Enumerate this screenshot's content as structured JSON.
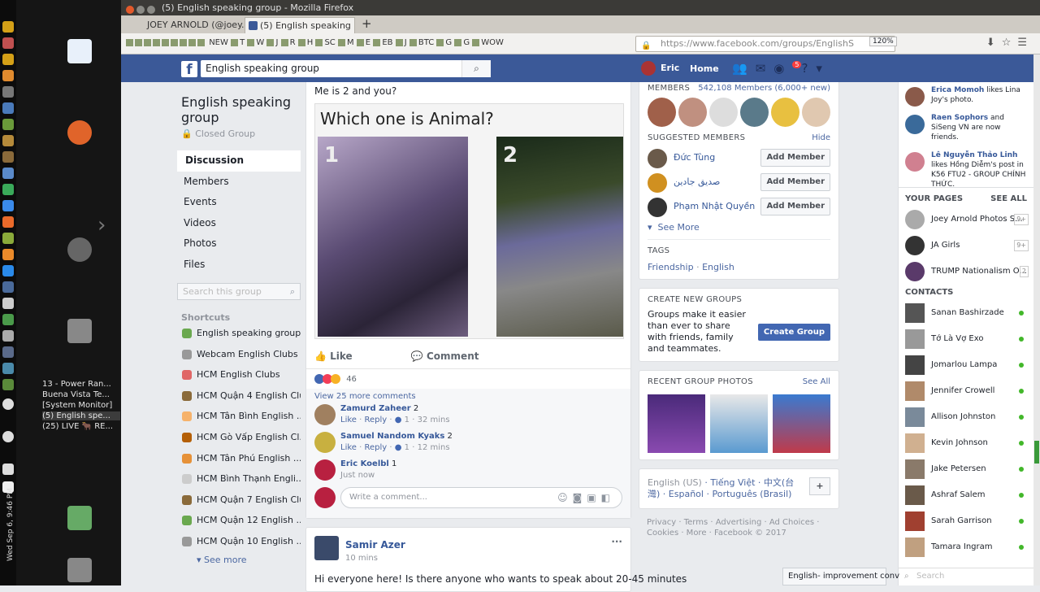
{
  "desktop": {
    "windows": [
      "13 - Power Ran...",
      "Buena Vista Te...",
      "[System Monitor]",
      "(5) English spe...",
      "(25) LIVE 🐂 RE..."
    ],
    "clock": "Wed Sep 6, 9:46 PM",
    "lang": "en"
  },
  "browser": {
    "title": "(5) English speaking group - Mozilla Firefox",
    "tabs": [
      {
        "label": "JOEY ARNOLD (@joey..."
      },
      {
        "label": "(5) English speaking gr..."
      }
    ],
    "bookmarks": [
      "NEW",
      "T",
      "W",
      "J",
      "R",
      "H",
      "SC",
      "M",
      "E",
      "EB",
      "J",
      "BTC",
      "G",
      "G",
      "WOW"
    ],
    "url": "https://www.facebook.com/groups/EnglishS",
    "zoom": "120%"
  },
  "fb": {
    "search_value": "English speaking group",
    "user": "Eric",
    "home": "Home",
    "notif_count": "5"
  },
  "left": {
    "group_name": "English speaking group",
    "privacy": "Closed Group",
    "nav": [
      "Discussion",
      "Members",
      "Events",
      "Videos",
      "Photos",
      "Files"
    ],
    "search_placeholder": "Search this group",
    "shortcuts_title": "Shortcuts",
    "shortcuts": [
      "English speaking group",
      "Webcam English Clubs",
      "HCM English Clubs",
      "HCM Quận 4 English Club",
      "HCM Tân Bình English ...",
      "HCM Gò Vấp English Cl...",
      "HCM Tân Phú English ...",
      "HCM Bình Thạnh Engli...",
      "HCM Quận 7 English Club",
      "HCM Quận 12 English ...",
      "HCM Quận 10 English ..."
    ],
    "see_more": "See more"
  },
  "post": {
    "text": "Me is 2 and you?",
    "meme_question": "Which one is Animal?",
    "meme_n1": "1",
    "meme_n2": "2",
    "like": "Like",
    "comment": "Comment",
    "reaction_count": "46",
    "view_more": "View 25 more comments",
    "comments": [
      {
        "name": "Zamurd Zaheer",
        "text": "2",
        "like": "Like",
        "reply": "Reply",
        "count": "1",
        "time": "32 mins"
      },
      {
        "name": "Samuel Nandom Kyaks",
        "text": "2",
        "like": "Like",
        "reply": "Reply",
        "count": "1",
        "time": "12 mins"
      },
      {
        "name": "Eric Koelbl",
        "text": "1",
        "time": "Just now"
      }
    ],
    "write_placeholder": "Write a comment..."
  },
  "post2": {
    "name": "Samir Azer",
    "time": "10 mins",
    "text": "Hi everyone here! Is there anyone who wants to speak about 20-45 minutes"
  },
  "right": {
    "members_title": "MEMBERS",
    "members_count": "542,108 Members (6,000+ new)",
    "suggested_title": "SUGGESTED MEMBERS",
    "hide": "Hide",
    "suggested": [
      {
        "name": "Đức Tùng"
      },
      {
        "name": "صديق جادين"
      },
      {
        "name": "Phạm Nhật Quyền"
      }
    ],
    "add_member": "Add Member",
    "see_more": "See More",
    "tags_title": "TAGS",
    "tag1": "Friendship",
    "tag2": "English",
    "create_title": "CREATE NEW GROUPS",
    "create_text": "Groups make it easier than ever to share with friends, family and teammates.",
    "create_btn": "Create Group",
    "photos_title": "RECENT GROUP PHOTOS",
    "see_all": "See All",
    "langs_current": "English (US)",
    "langs": [
      "Tiếng Việt",
      "中文(台灣)",
      "Español",
      "Português (Brasil)"
    ],
    "footer": "Privacy · Terms · Advertising · Ad Choices · Cookies · More · Facebook © 2017"
  },
  "chat": {
    "ticker": [
      {
        "name": "Erica Momoh",
        "text": "likes Lina Joy's photo."
      },
      {
        "name": "Raen Sophors",
        "text": "and SiSeng VN are now friends."
      },
      {
        "name": "Lê Nguyễn Thảo Linh",
        "text": "likes Hồng Diễm's post in K56 FTU2 - GROUP CHÍNH THỨC."
      }
    ],
    "pages_title": "YOUR PAGES",
    "see_all": "SEE ALL",
    "pages": [
      {
        "name": "Joey Arnold Photos S...",
        "count": "9+"
      },
      {
        "name": "JA Girls",
        "count": "9+"
      },
      {
        "name": "TRUMP Nationalism O...",
        "count": "2"
      }
    ],
    "contacts_title": "CONTACTS",
    "contacts": [
      "Sanan Bashirzade",
      "Tớ Là Vợ Exo",
      "Jomarlou Lampa",
      "Jennifer Crowell",
      "Allison Johnston",
      "Kevin Johnson",
      "Jake Petersen",
      "Ashraf Salem",
      "Sarah Garrison",
      "Tamara Ingram"
    ],
    "search_placeholder": "Search",
    "chat_tab": "English- improvement conv"
  }
}
